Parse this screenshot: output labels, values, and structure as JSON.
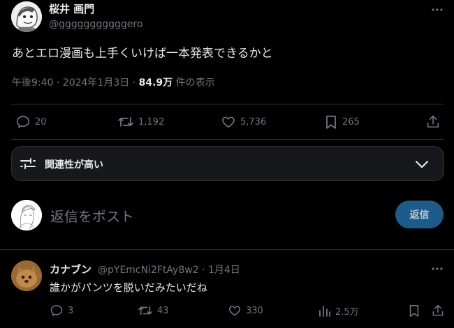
{
  "tweet": {
    "author_name": "桜井 画門",
    "author_handle": "@gggggggggggero",
    "text": "あとエロ漫画も上手くいけば一本発表できるかと",
    "time": "午後9:40 · 2024年1月3日 · ",
    "views_count": "84.9万",
    "views_label": " 件の表示",
    "stats": {
      "replies": "20",
      "retweets": "1,192",
      "likes": "5,736",
      "bookmarks": "265"
    }
  },
  "relevance_label": "関連性が高い",
  "composer": {
    "placeholder": "返信をポスト",
    "button_label": "返信"
  },
  "reply": {
    "author_name": "カナブン",
    "meta": "@pYEmcNi2FtAy8w2 · 1月4日",
    "text": "誰かがパンツを脱いだみたいだね",
    "stats": {
      "replies": "3",
      "retweets": "43",
      "likes": "330",
      "views": "2.5万"
    }
  },
  "icons": [
    "more-icon",
    "reply-icon",
    "retweet-icon",
    "like-icon",
    "bookmark-icon",
    "share-icon",
    "filter-icon",
    "chevron-down-icon",
    "views-icon"
  ],
  "colors": {
    "background": "#000000",
    "text": "#e7e9ea",
    "muted": "#71767b",
    "divider": "#2f3336",
    "reply_button": "#1d5c8a"
  }
}
